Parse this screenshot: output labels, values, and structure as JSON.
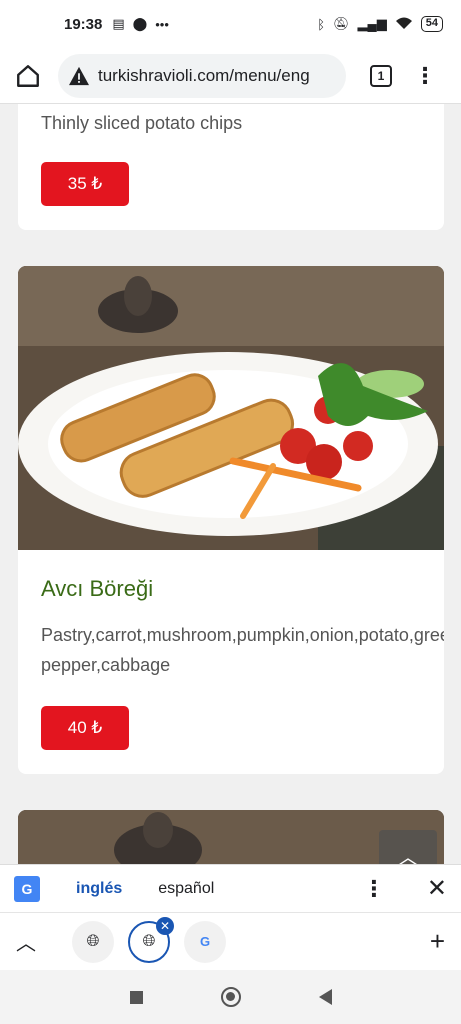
{
  "status_bar": {
    "time": "19:38",
    "left_icons": [
      "sim-card-icon",
      "location-pin-icon",
      "more-dots-icon"
    ],
    "right_icons": [
      "bluetooth-icon",
      "silent-bell-icon",
      "signal-r-icon",
      "wifi-icon"
    ],
    "battery_level": "54"
  },
  "browser": {
    "url": "turkishravioli.com/menu/eng",
    "tab_count": "1"
  },
  "menu": {
    "item1": {
      "description": "Thinly sliced potato chips",
      "price": "35 ₺"
    },
    "item2": {
      "title": "Avcı Böreği",
      "description_line1": "Pastry,carrot,mushroom,pumpkin,onion,potato,green",
      "description_line2": "pepper,cabbage",
      "price": "40 ₺"
    }
  },
  "translate_bar": {
    "lang_source": "inglés",
    "lang_target": "español"
  },
  "tab_strip": {
    "google_label": "G"
  },
  "colors": {
    "price_button": "#e3151f",
    "title_green": "#3a6b17",
    "translate_active": "#1a56b3"
  }
}
